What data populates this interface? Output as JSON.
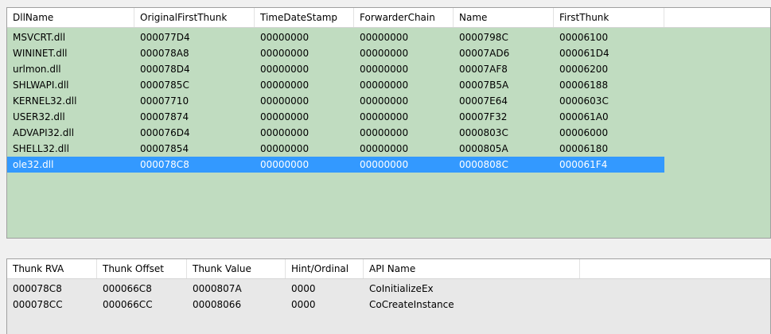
{
  "imports": {
    "columns": [
      "DllName",
      "OriginalFirstThunk",
      "TimeDateStamp",
      "ForwarderChain",
      "Name",
      "FirstThunk"
    ],
    "rows": [
      [
        "MSVCRT.dll",
        "000077D4",
        "00000000",
        "00000000",
        "0000798C",
        "00006100"
      ],
      [
        "WININET.dll",
        "000078A8",
        "00000000",
        "00000000",
        "00007AD6",
        "000061D4"
      ],
      [
        "urlmon.dll",
        "000078D4",
        "00000000",
        "00000000",
        "00007AF8",
        "00006200"
      ],
      [
        "SHLWAPI.dll",
        "0000785C",
        "00000000",
        "00000000",
        "00007B5A",
        "00006188"
      ],
      [
        "KERNEL32.dll",
        "00007710",
        "00000000",
        "00000000",
        "00007E64",
        "0000603C"
      ],
      [
        "USER32.dll",
        "00007874",
        "00000000",
        "00000000",
        "00007F32",
        "000061A0"
      ],
      [
        "ADVAPI32.dll",
        "000076D4",
        "00000000",
        "00000000",
        "0000803C",
        "00006000"
      ],
      [
        "SHELL32.dll",
        "00007854",
        "00000000",
        "00000000",
        "0000805A",
        "00006180"
      ],
      [
        "ole32.dll",
        "000078C8",
        "00000000",
        "00000000",
        "0000808C",
        "000061F4"
      ]
    ],
    "selected_row": 8
  },
  "thunks": {
    "columns": [
      "Thunk RVA",
      "Thunk Offset",
      "Thunk Value",
      "Hint/Ordinal",
      "API Name"
    ],
    "rows": [
      [
        "000078C8",
        "000066C8",
        "0000807A",
        "0000",
        "CoInitializeEx"
      ],
      [
        "000078CC",
        "000066CC",
        "00008066",
        "0000",
        "CoCreateInstance"
      ]
    ]
  },
  "colors": {
    "imports_background": "#c0dcc0",
    "selection": "#3399ff",
    "thunks_background": "#e8e8e8"
  }
}
